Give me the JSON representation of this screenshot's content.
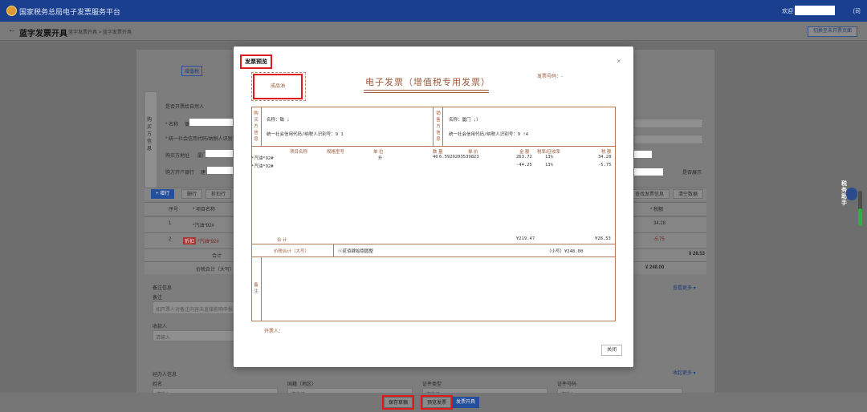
{
  "app": {
    "title": "国家税务总局电子发票服务平台",
    "user_label": "欢迎",
    "user_suffix": "(司"
  },
  "subbar": {
    "back": "←",
    "heading": "蓝字发票开具",
    "breadcrumb": "蓝字发票开具  >  蓝字发票开具",
    "switch_button": "切换至未开票页面"
  },
  "form": {
    "preview_tag": "增值税",
    "natural_person_checkbox": "是否开票给自然人",
    "buyer_section_label": "购买方信息",
    "name_label": "* 名称",
    "name_value": "锄",
    "taxid_label": "* 统一社会信用代码/纳税人识别号",
    "address_label": "购买方地址",
    "address_value": "厦门",
    "bank_label": "购方开户银行",
    "bank_value": "建",
    "show_toggle": "是否展示",
    "add_row_button": "+ 增行",
    "delete_row_button": "删行",
    "adjust_button": "折扣行",
    "dup_button": "查找发票信息",
    "clear_button": "清空数据",
    "table_headers": [
      "序号",
      "* 项目名称",
      "* 税额"
    ],
    "rows": [
      {
        "index": "1",
        "name": "*汽油*92#",
        "tax": "34.28"
      },
      {
        "index": "2",
        "tag": "折扣",
        "name": "*汽油*92#",
        "tax": "-5.75"
      }
    ],
    "total_label": "合计",
    "total_value": "¥ 28.53",
    "grand_label": "价税合计（大写）",
    "grand_value": "¥ 248.00",
    "remark_section": "备注信息",
    "remark_label": "备注",
    "remark_placeholder": "如开票人对备注内容未直接影响申报...",
    "payee_label": "收款人",
    "payee_placeholder": "请输入",
    "more_link": "查看更多 ▾",
    "agent_section": "经办人信息",
    "agent_more": "收起更多 ▾",
    "agent_fields": [
      "姓名",
      "国籍（地区）",
      "证件类型",
      "证件号码"
    ],
    "agent_placeholders": [
      "请输入",
      "请选择",
      "请选择",
      "请输入"
    ]
  },
  "bottom_buttons": {
    "save_draft": "保存草稿",
    "preview": "预览发票",
    "issue": "发票开具"
  },
  "robot": {
    "label": "税务助手"
  },
  "modal": {
    "title": "发票预览",
    "close_x": "×",
    "close_button": "关闭"
  },
  "invoice": {
    "seal_text": "成品油",
    "title": "电子发票（增值税专用发票）",
    "invoice_no_label": "发票号码：-",
    "buyer_side_label": "购买方信息",
    "seller_side_label": "销售方信息",
    "buyer_name": "名称：锄                    ;司",
    "buyer_taxid": "统一社会信用代码/纳税人识别号：9                    1",
    "seller_name": "名称：厦门                    ;司",
    "seller_taxid": "统一社会信用代码/纳税人识别号：9                    !4",
    "col_headers": [
      "项目名称",
      "规格型号",
      "单 位",
      "数 量",
      "单 价",
      "金 额",
      "税率/征收率",
      "税 额"
    ],
    "items": [
      {
        "name": "*汽油*92#",
        "unit": "升",
        "qty": "40",
        "price": "6.5929203539823",
        "amount": "263.72",
        "rate": "13%",
        "tax": "34.28"
      },
      {
        "name": "*汽油*92#",
        "unit": "",
        "qty": "",
        "price": "",
        "amount": "-44.25",
        "rate": "13%",
        "tax": "-5.75"
      }
    ],
    "total_label": "合 计",
    "total_amount": "¥219.47",
    "total_tax": "¥28.53",
    "grand_label": "价税合计（大写）",
    "grand_words": "ⓧ贰佰肆拾捌圆整",
    "grand_small": "（小写）¥248.00",
    "remark_label": "备注",
    "drawer_label": "开票人："
  }
}
